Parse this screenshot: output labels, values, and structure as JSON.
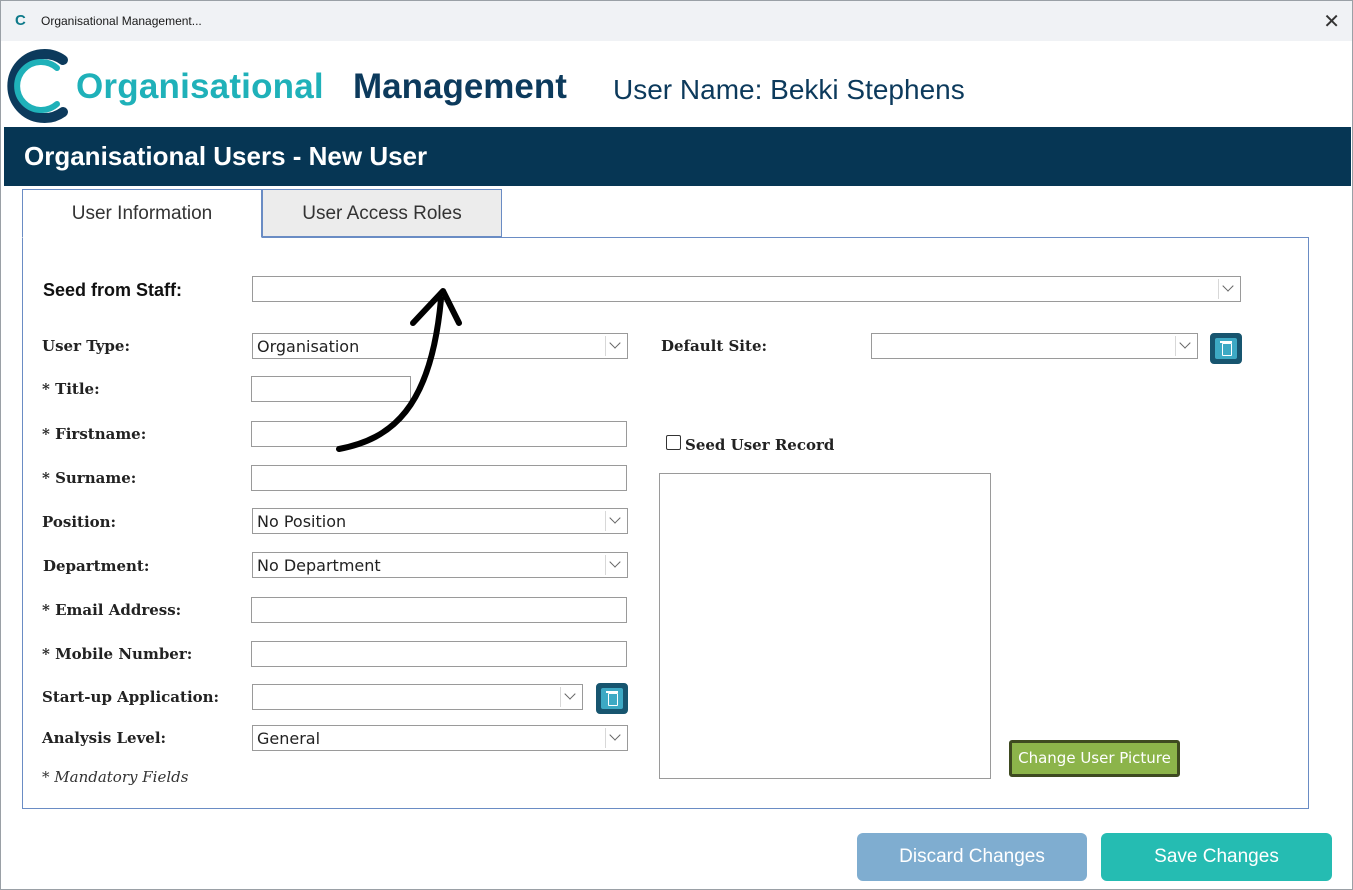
{
  "window": {
    "title": "Organisational Management...",
    "app_icon": "C",
    "close_glyph": "✕"
  },
  "header": {
    "brand_part1": "Organisational",
    "brand_part2": "Management",
    "user_name_label": "User Name: Bekki Stephens"
  },
  "banner": {
    "title": "Organisational Users - New User"
  },
  "tabs": [
    {
      "label": "User Information",
      "active": true
    },
    {
      "label": "User Access Roles",
      "active": false
    }
  ],
  "form": {
    "seed_from_staff": {
      "label": "Seed from Staff:",
      "value": ""
    },
    "user_type": {
      "label": "User Type:",
      "value": "Organisation"
    },
    "title": {
      "label": "* Title:",
      "value": ""
    },
    "firstname": {
      "label": "* Firstname:",
      "value": ""
    },
    "surname": {
      "label": "* Surname:",
      "value": ""
    },
    "position": {
      "label": "Position:",
      "value": "No Position"
    },
    "department": {
      "label": "Department:",
      "value": "No Department"
    },
    "email": {
      "label": "* Email Address:",
      "value": ""
    },
    "mobile": {
      "label": "* Mobile Number:",
      "value": ""
    },
    "startup_app": {
      "label": "Start-up Application:",
      "value": ""
    },
    "analysis_level": {
      "label": "Analysis Level:",
      "value": "General"
    },
    "mandatory_note": "* Mandatory Fields",
    "default_site": {
      "label": "Default Site:",
      "value": ""
    },
    "seed_user_record": {
      "label": "Seed User Record",
      "checked": false
    },
    "change_picture_label": "Change User Picture"
  },
  "footer": {
    "discard_label": "Discard Changes",
    "save_label": "Save Changes"
  },
  "colors": {
    "brand_teal": "#1fb1b9",
    "brand_navy": "#0c3a5c",
    "banner": "#063654",
    "discard": "#7fadd0",
    "save": "#25bcb2",
    "picture_button": "#8cb44a"
  },
  "icons": [
    "app-logo-icon",
    "close-icon",
    "chevron-down-icon",
    "clear-trash-icon",
    "annotation-arrow-icon"
  ]
}
